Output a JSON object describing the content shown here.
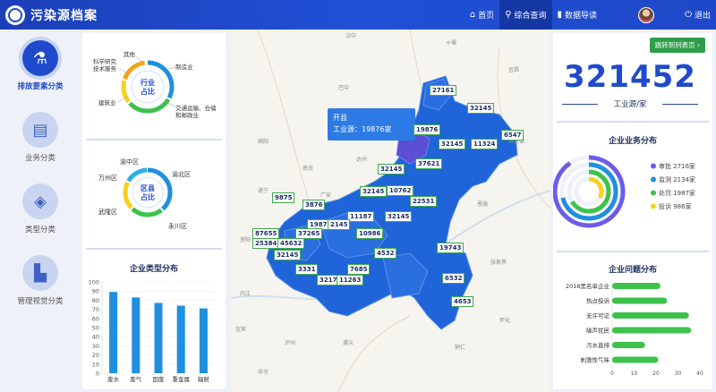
{
  "header": {
    "title": "污染源档案",
    "nav": [
      {
        "label": "首页",
        "icon": "home-icon"
      },
      {
        "label": "综合查询",
        "icon": "search-icon"
      },
      {
        "label": "数据导读",
        "icon": "bar-chart-icon"
      }
    ],
    "logout": "退出"
  },
  "sidebar": {
    "items": [
      {
        "label": "排放要素分类",
        "icon": "flask-icon",
        "active": true
      },
      {
        "label": "业务分类",
        "icon": "briefcase-icon",
        "active": false
      },
      {
        "label": "类型分类",
        "icon": "tag-icon",
        "active": false
      },
      {
        "label": "管理视觉分类",
        "icon": "factory-icon",
        "active": false
      }
    ]
  },
  "industry_ratio": {
    "center_line1": "行业",
    "center_line2": "占比",
    "labels": [
      "其他",
      "科学研究",
      "技术服务",
      "制造业",
      "建筑业",
      "交通运输、仓储",
      "和邮政业"
    ],
    "colors": [
      "#1f8fe0",
      "#3ec24c",
      "#f3a41e",
      "#2bb0e8",
      "#f7d11e"
    ]
  },
  "district_ratio": {
    "center_line1": "区县",
    "center_line2": "占比",
    "labels": [
      "渝中区",
      "万州区",
      "渝北区",
      "武隆区",
      "永川区"
    ]
  },
  "enterprise_type": {
    "title": "企业类型分布",
    "chart_data": {
      "type": "bar",
      "categories": [
        "废水",
        "废气",
        "固废",
        "重金属",
        "辐射"
      ],
      "values": [
        89,
        83,
        77,
        74,
        71
      ],
      "ylim": [
        0,
        100
      ],
      "yticks": [
        0,
        10,
        20,
        30,
        40,
        50,
        60,
        70,
        80,
        90,
        100
      ]
    }
  },
  "map": {
    "tooltip_title": "开县",
    "tooltip_label": "工业源：",
    "tooltip_value": "19876家",
    "values": [
      "27161",
      "32145",
      "6547",
      "11324",
      "19876",
      "32145",
      "37621",
      "32145",
      "10762",
      "22531",
      "32145",
      "9875",
      "3876",
      "11187",
      "32145",
      "19876",
      "37265",
      "2145",
      "10986",
      "87655",
      "25384",
      "45632",
      "32145",
      "4532",
      "19743",
      "3331",
      "7685",
      "32176",
      "11263",
      "6532",
      "4653"
    ],
    "place_labels": [
      "城口县",
      "巫溪县",
      "巫山县",
      "开县",
      "云阳县",
      "奉节县",
      "万州区",
      "忠县",
      "石柱",
      "垫江县",
      "梁平县",
      "长寿区",
      "涪陵区",
      "丰都县",
      "武隆县",
      "南川区",
      "綦江区",
      "江津区",
      "永川区",
      "荣昌县",
      "大足区",
      "铜梁区",
      "潼南县",
      "合川区",
      "北碚区",
      "渝北区",
      "璧山区",
      "巴南区",
      "黔江区",
      "彭水县",
      "酉阳县",
      "秀山县",
      "达州",
      "广安",
      "南充",
      "巴中",
      "遂宁",
      "泸州",
      "遵义",
      "铜仁",
      "恩施",
      "张家界",
      "宜昌",
      "汉中",
      "十堰",
      "毕节",
      "贵阳",
      "内江",
      "资阳",
      "宜宾",
      "怀化",
      "安康",
      "绵阳",
      "神农架"
    ]
  },
  "right": {
    "jump_button": "跳转到列表页",
    "total": "321452",
    "unit": "工业源/家",
    "business_title": "企业业务分布",
    "business_chart": {
      "type": "pie",
      "series": [
        {
          "name": "审批",
          "value": 2716,
          "label": "审批 2716家",
          "color": "#6c5ce7"
        },
        {
          "name": "监测",
          "value": 2134,
          "label": "监测 2134家",
          "color": "#1f8fe0"
        },
        {
          "name": "处罚",
          "value": 1987,
          "label": "处罚 1987家",
          "color": "#3ec24c"
        },
        {
          "name": "投诉",
          "value": 986,
          "label": "投诉 986家",
          "color": "#f7d11e"
        }
      ]
    },
    "problem_title": "企业问题分布",
    "problem_chart": {
      "type": "bar",
      "categories": [
        "2018黑名单企业",
        "热点投诉",
        "无许可证",
        "噪声扰民",
        "污水直排",
        "刺激性气味"
      ],
      "values": [
        22,
        25,
        35,
        36,
        15,
        21
      ],
      "xlim": [
        0,
        40
      ],
      "xticks": [
        0,
        10,
        20,
        30,
        40
      ]
    }
  }
}
